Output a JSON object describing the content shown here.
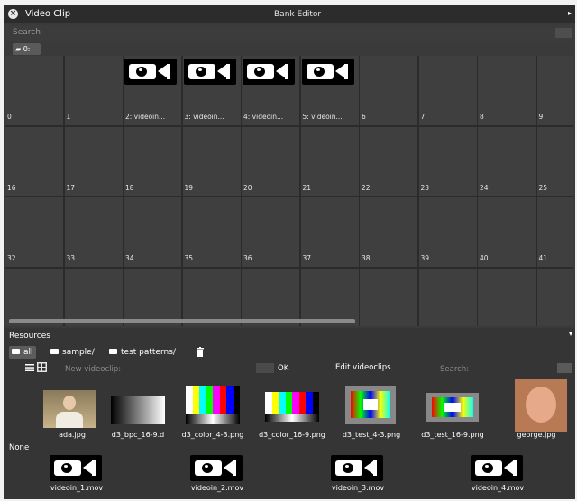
{
  "window": {
    "title": "Video Clip",
    "panel_title": "Bank Editor"
  },
  "search": {
    "label": "Search"
  },
  "bank_tab": {
    "label": "0:"
  },
  "grid": {
    "cells": [
      {
        "label": "0",
        "clip": false
      },
      {
        "label": "1",
        "clip": false
      },
      {
        "label": "2: videoin...",
        "clip": true
      },
      {
        "label": "3: videoin...",
        "clip": true
      },
      {
        "label": "4: videoin...",
        "clip": true
      },
      {
        "label": "5: videoin...",
        "clip": true
      },
      {
        "label": "6",
        "clip": false
      },
      {
        "label": "7",
        "clip": false
      },
      {
        "label": "8",
        "clip": false
      },
      {
        "label": "9",
        "clip": false
      },
      {
        "label": "16",
        "clip": false
      },
      {
        "label": "17",
        "clip": false
      },
      {
        "label": "18",
        "clip": false
      },
      {
        "label": "19",
        "clip": false
      },
      {
        "label": "20",
        "clip": false
      },
      {
        "label": "21",
        "clip": false
      },
      {
        "label": "22",
        "clip": false
      },
      {
        "label": "23",
        "clip": false
      },
      {
        "label": "24",
        "clip": false
      },
      {
        "label": "25",
        "clip": false
      },
      {
        "label": "32",
        "clip": false
      },
      {
        "label": "33",
        "clip": false
      },
      {
        "label": "34",
        "clip": false
      },
      {
        "label": "35",
        "clip": false
      },
      {
        "label": "36",
        "clip": false
      },
      {
        "label": "37",
        "clip": false
      },
      {
        "label": "38",
        "clip": false
      },
      {
        "label": "39",
        "clip": false
      },
      {
        "label": "40",
        "clip": false
      },
      {
        "label": "41",
        "clip": false
      },
      {
        "label": "",
        "clip": false
      },
      {
        "label": "",
        "clip": false
      },
      {
        "label": "",
        "clip": false
      },
      {
        "label": "",
        "clip": false
      },
      {
        "label": "",
        "clip": false
      },
      {
        "label": "",
        "clip": false
      },
      {
        "label": "",
        "clip": false
      },
      {
        "label": "",
        "clip": false
      },
      {
        "label": "",
        "clip": false
      },
      {
        "label": "",
        "clip": false
      }
    ]
  },
  "resources": {
    "title": "Resources",
    "folders": [
      "all",
      "sample/",
      "test patterns/"
    ],
    "new_videoclip_label": "New videoclip:",
    "ok_label": "OK",
    "edit_label": "Edit videoclips",
    "search_label": "Search:",
    "none_label": "None",
    "images": [
      {
        "name": "ada.jpg",
        "kind": "portrait"
      },
      {
        "name": "d3_bpc_16-9.d",
        "kind": "gradient"
      },
      {
        "name": "d3_color_4-3.png",
        "kind": "bars"
      },
      {
        "name": "d3_color_16-9.png",
        "kind": "bars"
      },
      {
        "name": "d3_test_4-3.png",
        "kind": "testcard"
      },
      {
        "name": "d3_test_16-9.png",
        "kind": "testcard"
      },
      {
        "name": "george.jpg",
        "kind": "portrait2"
      }
    ],
    "videos": [
      "videoin_1.mov",
      "videoin_2.mov",
      "videoin_3.mov",
      "videoin_4.mov"
    ]
  },
  "colors": {
    "window_bg": "#3a3a3a",
    "cell_bg": "#3f3f3f",
    "titlebar": "#2c2c2c"
  }
}
